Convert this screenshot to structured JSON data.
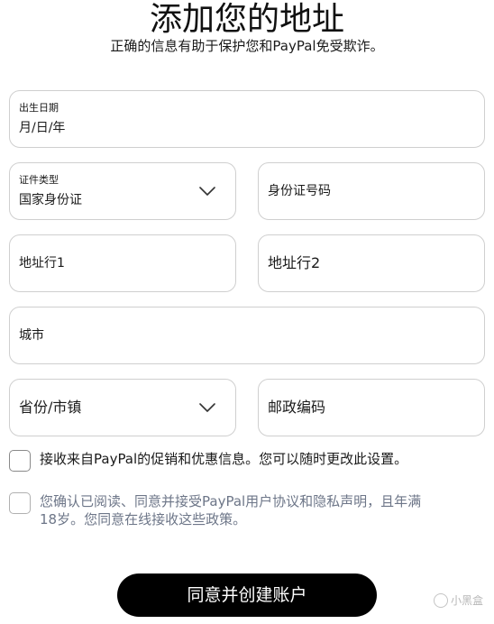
{
  "header": {
    "title": "添加您的地址",
    "subtitle": "正确的信息有助于保护您和PayPal免受欺诈。"
  },
  "form": {
    "dob": {
      "label": "出生日期",
      "value": "月/日/年"
    },
    "id_type": {
      "label": "证件类型",
      "value": "国家身份证"
    },
    "id_number": {
      "placeholder": "身份证号码"
    },
    "address1": {
      "placeholder": "地址行1"
    },
    "address2": {
      "placeholder": "地址行2"
    },
    "city": {
      "placeholder": "城市"
    },
    "state": {
      "placeholder": "省份/市镇"
    },
    "postcode": {
      "placeholder": "邮政编码"
    }
  },
  "checkboxes": {
    "promo": {
      "text": "接收来自PayPal的促销和优惠信息。您可以随时更改此设置。",
      "checked": false
    },
    "terms": {
      "line1": "您确认已阅读、同意并接受PayPal用户协议和隐私声明，且年满",
      "line2": "18岁。您同意在线接收这些政策。",
      "checked": false
    }
  },
  "actions": {
    "submit_label": "同意并创建账户"
  },
  "watermark": {
    "text": "小黑盒"
  },
  "icons": {
    "dropdown": "chevron-down-icon",
    "watermark": "circle-icon"
  },
  "colors": {
    "button_bg": "#000000",
    "button_text": "#ffffff",
    "field_border": "#cfcfcf",
    "muted_text": "#6d7688"
  }
}
